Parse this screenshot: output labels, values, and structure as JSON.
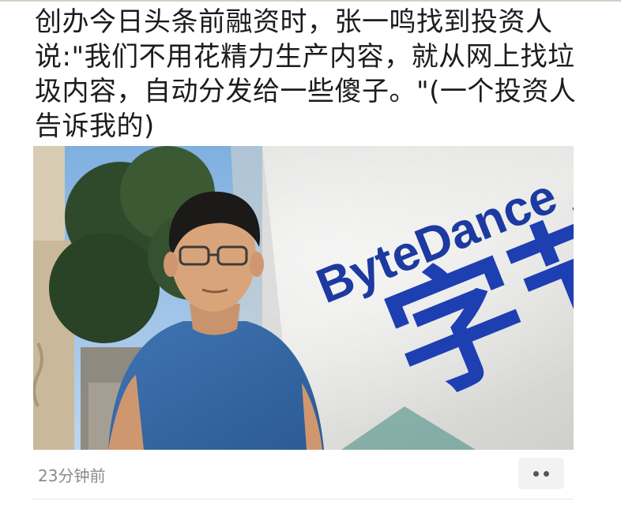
{
  "article": {
    "headline": "创办今日头条前融资时，张一鸣找到投资人说:\"我们不用花精力生产内容，就从网上找垃圾内容，自动分发给一些傻子。\"(一个投资人告诉我的)",
    "image": {
      "sign_text": "ByteDance",
      "logo_chars": "字节"
    },
    "timestamp": "23分钟前"
  },
  "actions": {
    "more_icon": "more-dots-icon"
  }
}
